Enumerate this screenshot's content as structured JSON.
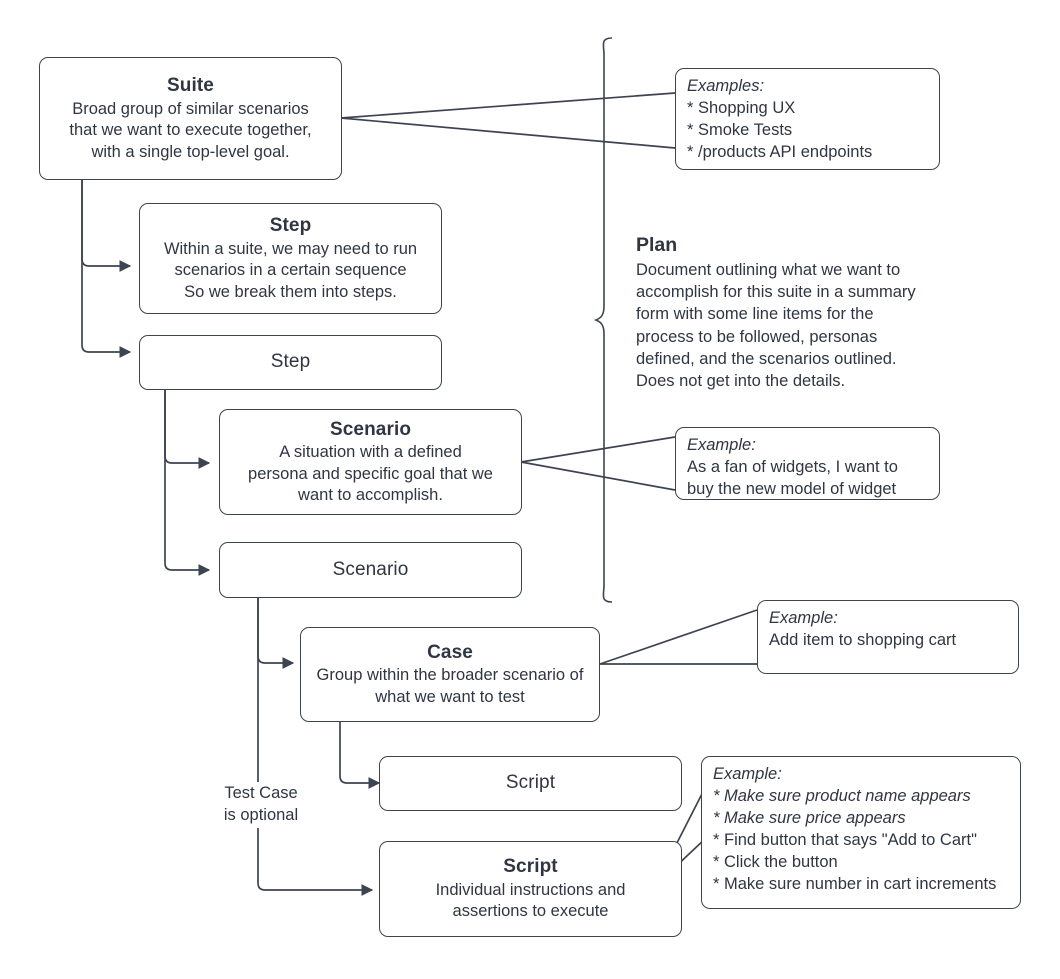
{
  "diagram": {
    "title": "Test hierarchy: Suite / Step / Scenario / Case / Script",
    "stroke_color": "#3d4451",
    "text_color": "#2f3642",
    "background": "#ffffff"
  },
  "nodes": {
    "suite": {
      "title": "Suite",
      "body_lines": [
        "Broad group of similar scenarios",
        "that we want to execute together,",
        "with a single top-level goal."
      ]
    },
    "step_detailed": {
      "title": "Step",
      "body_lines": [
        "Within a suite, we may need to run",
        "scenarios in a certain sequence",
        "So we break them into steps."
      ]
    },
    "step_plain": {
      "title": "Step",
      "body_lines": []
    },
    "scenario_detailed": {
      "title": "Scenario",
      "body_lines": [
        "A situation with a defined",
        "persona and specific goal that we",
        "want to accomplish."
      ]
    },
    "scenario_plain": {
      "title": "Scenario",
      "body_lines": []
    },
    "case": {
      "title": "Case",
      "body_lines": [
        "Group within the broader scenario of",
        "what we want to test"
      ]
    },
    "script_plain": {
      "title": "Script",
      "body_lines": []
    },
    "script_detailed": {
      "title": "Script",
      "body_lines": [
        "Individual instructions and",
        "assertions to execute"
      ]
    }
  },
  "callouts": {
    "suite_examples": {
      "lead": "Examples:",
      "items": [
        "* Shopping UX",
        "* Smoke Tests",
        "* /products API endpoints"
      ]
    },
    "scenario_example": {
      "lead": "Example:",
      "items": [
        "As a fan of widgets, I want to",
        "buy the new model of widget"
      ]
    },
    "case_example": {
      "lead": "Example:",
      "items": [
        "Add item to shopping cart"
      ]
    },
    "script_example": {
      "lead": "Example:",
      "items": [
        {
          "text": "* Make sure product name appears",
          "italic": true
        },
        {
          "text": "* Make sure price appears",
          "italic": true
        },
        {
          "text": "* Find button that says \"Add to Cart\"",
          "italic": false
        },
        {
          "text": "* Click the button",
          "italic": false
        },
        {
          "text": "* Make sure number in cart increments",
          "italic": false
        }
      ]
    }
  },
  "plan": {
    "title": "Plan",
    "body_lines": [
      "Document outlining what we want to",
      "accomplish for this suite in a summary",
      "form with some line items for the",
      "process to be followed, personas",
      "defined, and the scenarios outlined.",
      "Does not get into the details."
    ]
  },
  "labels": {
    "test_case_optional": "Test Case\nis optional"
  }
}
